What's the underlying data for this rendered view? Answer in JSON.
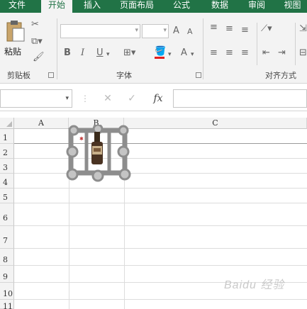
{
  "tabs": [
    {
      "label": "文件",
      "active": false
    },
    {
      "label": "开始",
      "active": true
    },
    {
      "label": "插入",
      "active": false
    },
    {
      "label": "页面布局",
      "active": false
    },
    {
      "label": "公式",
      "active": false
    },
    {
      "label": "数据",
      "active": false
    },
    {
      "label": "审阅",
      "active": false
    },
    {
      "label": "视图",
      "active": false
    }
  ],
  "ribbon": {
    "clipboard": {
      "paste_label": "粘贴",
      "group_label": "剪贴板"
    },
    "font": {
      "group_label": "字体",
      "bold": "B",
      "italic": "I",
      "underline": "U",
      "grow": "A",
      "shrink": "A",
      "font_color": "A"
    },
    "alignment": {
      "group_label": "对齐方式"
    }
  },
  "formula_bar": {
    "name_box_value": "",
    "cancel": "✕",
    "enter": "✓",
    "fx": "fx",
    "formula_value": ""
  },
  "sheet": {
    "columns": [
      "A",
      "B",
      "C"
    ],
    "rows": [
      "1",
      "2",
      "3",
      "4",
      "5",
      "6",
      "7",
      "8",
      "9",
      "10",
      "11"
    ]
  },
  "watermark": "Baidu 经验",
  "colors": {
    "accent": "#217346"
  }
}
